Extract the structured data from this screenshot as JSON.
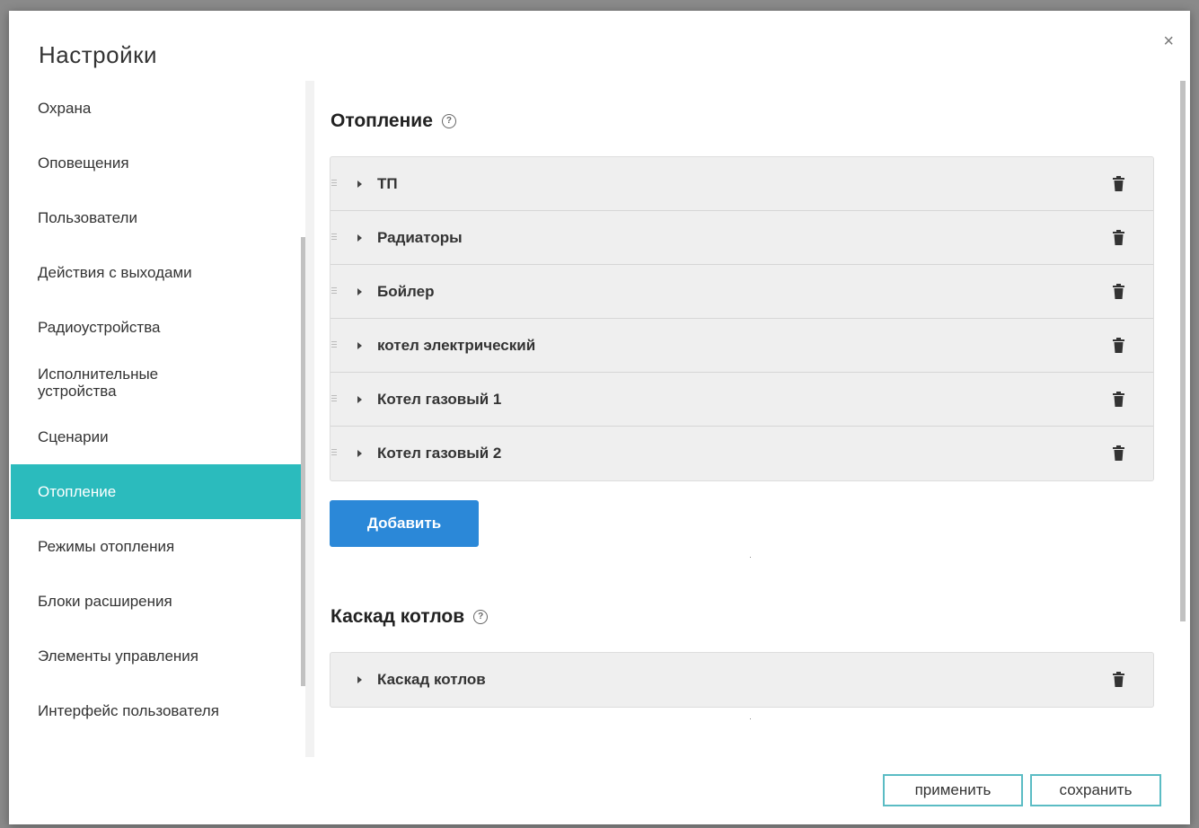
{
  "modal": {
    "title": "Настройки",
    "close_label": "×"
  },
  "sidebar": {
    "items": [
      {
        "label": "Охрана"
      },
      {
        "label": "Оповещения"
      },
      {
        "label": "Пользователи"
      },
      {
        "label": "Действия с выходами"
      },
      {
        "label": "Радиоустройства"
      },
      {
        "label": "Исполнительные устройства"
      },
      {
        "label": "Сценарии"
      },
      {
        "label": "Отопление",
        "active": true
      },
      {
        "label": "Режимы отопления"
      },
      {
        "label": "Блоки расширения"
      },
      {
        "label": "Элементы управления"
      },
      {
        "label": "Интерфейс пользователя"
      }
    ]
  },
  "heating": {
    "title": "Отопление",
    "help_icon": "?",
    "rows": [
      {
        "label": "ТП"
      },
      {
        "label": "Радиаторы"
      },
      {
        "label": "Бойлер"
      },
      {
        "label": "котел электрический"
      },
      {
        "label": "Котел газовый 1"
      },
      {
        "label": "Котел газовый 2"
      }
    ],
    "add_label": "Добавить"
  },
  "cascade": {
    "title": "Каскад котлов",
    "help_icon": "?",
    "rows": [
      {
        "label": "Каскад котлов"
      }
    ]
  },
  "footer": {
    "apply_label": "применить",
    "save_label": "сохранить"
  },
  "colors": {
    "accent_active": "#2bbbbd",
    "primary_button": "#2b88d8",
    "footer_border": "#5bbcc4"
  }
}
